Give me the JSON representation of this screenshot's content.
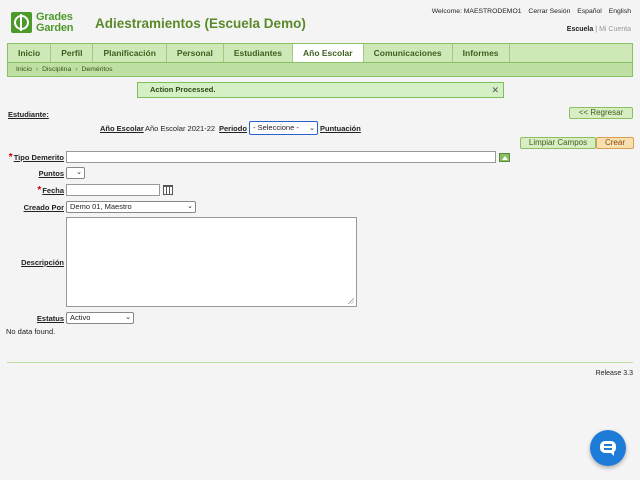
{
  "brand": {
    "line1": "Grades",
    "line2": "Garden",
    "app_title": "Adiestramientos (Escuela Demo)"
  },
  "top_links": {
    "welcome": "Welcome: MAESTRODEMO1",
    "logout": "Cerrar Sesión",
    "spanish": "Español",
    "english": "English"
  },
  "account": {
    "school": "Escuela",
    "my_account": "Mi Cuenta"
  },
  "nav": {
    "tabs": [
      "Inicio",
      "Perfil",
      "Planificación",
      "Personal",
      "Estudiantes",
      "Año Escolar",
      "Comunicaciones",
      "Informes"
    ],
    "active": "Año Escolar"
  },
  "breadcrumb": [
    "Inicio",
    "Disciplina",
    "Deméritos"
  ],
  "message": {
    "text": "Action Processed.",
    "close": "✕"
  },
  "student_label": "Estudiante:",
  "back_button": "<< Regresar",
  "year_row": {
    "year_label": "Año Escolar",
    "year_value": "Año Escolar 2021-22",
    "period_label": "Periodo",
    "period_value": "- Seleccione -",
    "score_label": "Puntuación"
  },
  "buttons": {
    "clear": "Limpiar Campos",
    "create": "Crear"
  },
  "form": {
    "tipo_label": "Tipo Demerito",
    "tipo_value": "",
    "puntos_label": "Puntos",
    "puntos_value": "",
    "fecha_label": "Fecha",
    "fecha_value": "",
    "creado_label": "Creado Por",
    "creado_value": "Demo 01, Maestro",
    "descripcion_label": "Descripción",
    "descripcion_value": "",
    "estatus_label": "Estatus",
    "estatus_value": "Activo",
    "required_mark": "*"
  },
  "no_data": "No data found.",
  "release": "Release 3.3",
  "colors": {
    "brand_green": "#4c9a2a",
    "nav_bg": "#cfe8b8",
    "chat_blue": "#1d7cd8",
    "required_red": "#cc0000"
  },
  "icons": {
    "chat": "chat-bubble-icon",
    "calendar": "calendar-icon",
    "expand": "arrow-up-icon",
    "close": "close-icon"
  }
}
